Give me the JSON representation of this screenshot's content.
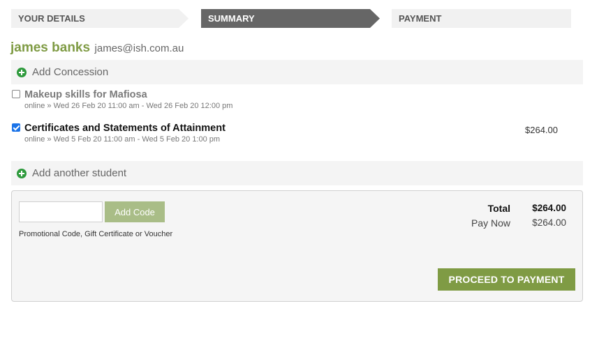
{
  "steps": [
    {
      "label": "YOUR DETAILS"
    },
    {
      "label": "SUMMARY"
    },
    {
      "label": "PAYMENT"
    }
  ],
  "student": {
    "name": "james banks",
    "email": "james@ish.com.au"
  },
  "add_concession_label": "Add Concession",
  "courses": [
    {
      "title": "Makeup skills for Mafiosa",
      "meta": "online » Wed 26 Feb 20 11:00 am - Wed 26 Feb 20 12:00 pm",
      "checked": false,
      "price": ""
    },
    {
      "title": "Certificates and Statements of Attainment",
      "meta": "online » Wed 5 Feb 20 11:00 am - Wed 5 Feb 20 1:00 pm",
      "checked": true,
      "price": "$264.00"
    }
  ],
  "add_student_label": "Add another student",
  "promo": {
    "input_value": "",
    "button_label": "Add Code",
    "help_text": "Promotional Code, Gift Certificate or Voucher"
  },
  "totals": {
    "total_label": "Total",
    "total_value": "$264.00",
    "paynow_label": "Pay Now",
    "paynow_value": "$264.00"
  },
  "proceed_label": "PROCEED TO PAYMENT",
  "colors": {
    "accent": "#7f9b44",
    "active_step": "#666666",
    "plus_icon": "#2e9a3c"
  }
}
